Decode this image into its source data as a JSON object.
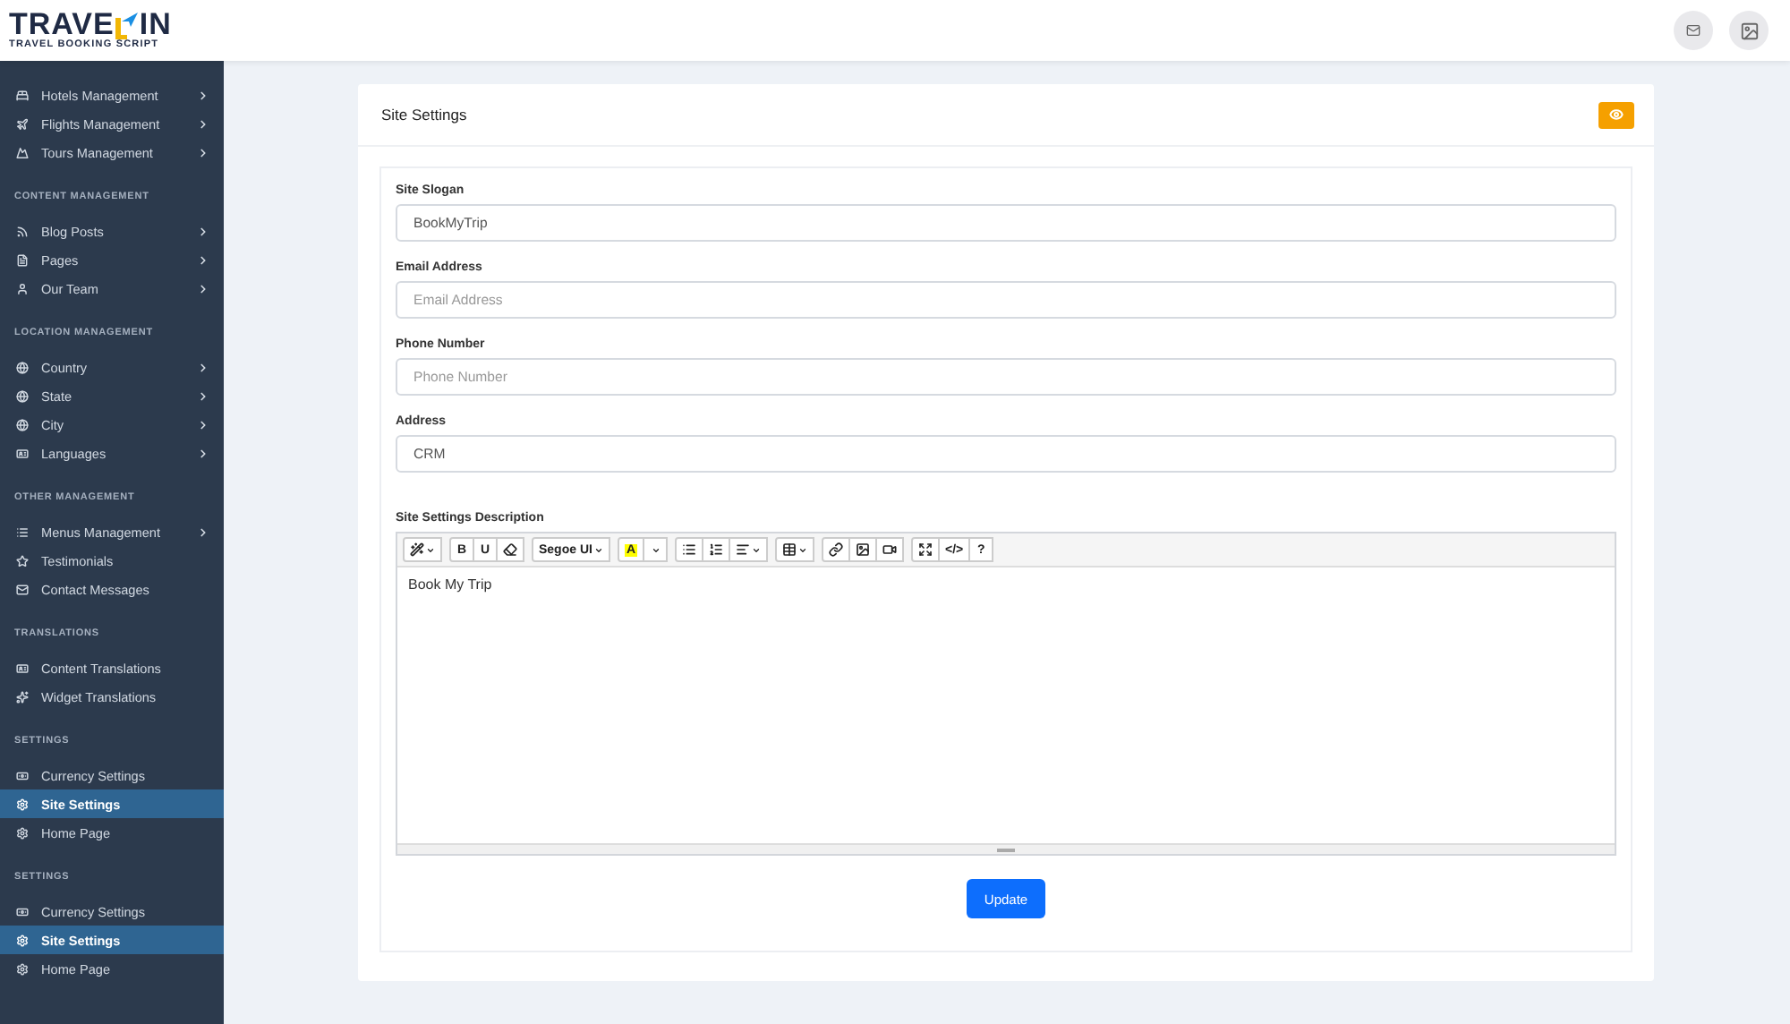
{
  "header": {
    "logo": {
      "name_start": "TRAVE",
      "name_end": "IN",
      "tagline": "TRAVEL BOOKING SCRIPT"
    }
  },
  "sidebar": {
    "sections": [
      {
        "items": [
          {
            "label": "Hotels Management",
            "expandable": true,
            "selected": false
          },
          {
            "label": "Flights Management",
            "expandable": true,
            "selected": false
          },
          {
            "label": "Tours Management",
            "expandable": true,
            "selected": false
          }
        ]
      },
      {
        "title": "CONTENT MANAGEMENT",
        "items": [
          {
            "label": "Blog Posts",
            "expandable": true,
            "selected": false
          },
          {
            "label": "Pages",
            "expandable": true,
            "selected": false
          },
          {
            "label": "Our Team",
            "expandable": true,
            "selected": false
          }
        ]
      },
      {
        "title": "LOCATION MANAGEMENT",
        "items": [
          {
            "label": "Country",
            "expandable": true,
            "selected": false
          },
          {
            "label": "State",
            "expandable": true,
            "selected": false
          },
          {
            "label": "City",
            "expandable": true,
            "selected": false
          },
          {
            "label": "Languages",
            "expandable": true,
            "selected": false
          }
        ]
      },
      {
        "title": "OTHER MANAGEMENT",
        "items": [
          {
            "label": "Menus Management",
            "expandable": true,
            "selected": false
          },
          {
            "label": "Testimonials",
            "expandable": false,
            "selected": false
          },
          {
            "label": "Contact Messages",
            "expandable": false,
            "selected": false
          }
        ]
      },
      {
        "title": "TRANSLATIONS",
        "items": [
          {
            "label": "Content Translations",
            "expandable": false,
            "selected": false
          },
          {
            "label": "Widget Translations",
            "expandable": false,
            "selected": false
          }
        ]
      },
      {
        "title": "SETTINGS",
        "items": [
          {
            "label": "Currency Settings",
            "expandable": false,
            "selected": false
          },
          {
            "label": "Site Settings",
            "expandable": false,
            "selected": true
          },
          {
            "label": "Home Page",
            "expandable": false,
            "selected": false
          }
        ]
      },
      {
        "title": "SETTINGS",
        "items": [
          {
            "label": "Currency Settings",
            "expandable": false,
            "selected": false
          },
          {
            "label": "Site Settings",
            "expandable": false,
            "selected": true
          },
          {
            "label": "Home Page",
            "expandable": false,
            "selected": false
          }
        ]
      }
    ]
  },
  "card": {
    "title": "Site Settings",
    "fields": [
      {
        "label": "Site Slogan",
        "value": "BookMyTrip"
      },
      {
        "label": "Email Address",
        "placeholder": "Email Address"
      },
      {
        "label": "Phone Number",
        "placeholder": "Phone Number"
      },
      {
        "label": "Address",
        "value": "CRM"
      }
    ],
    "description": {
      "label": "Site Settings Description",
      "toolbar": [
        [
          {
            "kind": "wand",
            "caret": true
          }
        ],
        [
          {
            "kind": "text",
            "label": "B",
            "caret": false
          },
          {
            "kind": "text",
            "label": "U",
            "caret": false
          },
          {
            "kind": "eraser",
            "caret": false
          }
        ],
        [
          {
            "kind": "text",
            "label": "Segoe UI",
            "caret": true
          }
        ],
        [
          {
            "kind": "highlight",
            "label": "A",
            "caret": false
          },
          {
            "kind": "caret",
            "caret": false
          }
        ],
        [
          {
            "kind": "bullets",
            "caret": false
          },
          {
            "kind": "numbers",
            "caret": false
          },
          {
            "kind": "align",
            "caret": true
          }
        ],
        [
          {
            "kind": "table",
            "caret": true
          }
        ],
        [
          {
            "kind": "link",
            "caret": false
          },
          {
            "kind": "image",
            "caret": false
          },
          {
            "kind": "video",
            "caret": false
          }
        ],
        [
          {
            "kind": "fullscreen",
            "caret": false
          },
          {
            "kind": "text",
            "label": "</>",
            "caret": false
          },
          {
            "kind": "text",
            "label": "?",
            "caret": false
          }
        ]
      ],
      "content": "Book My Trip"
    },
    "button": "Update"
  }
}
